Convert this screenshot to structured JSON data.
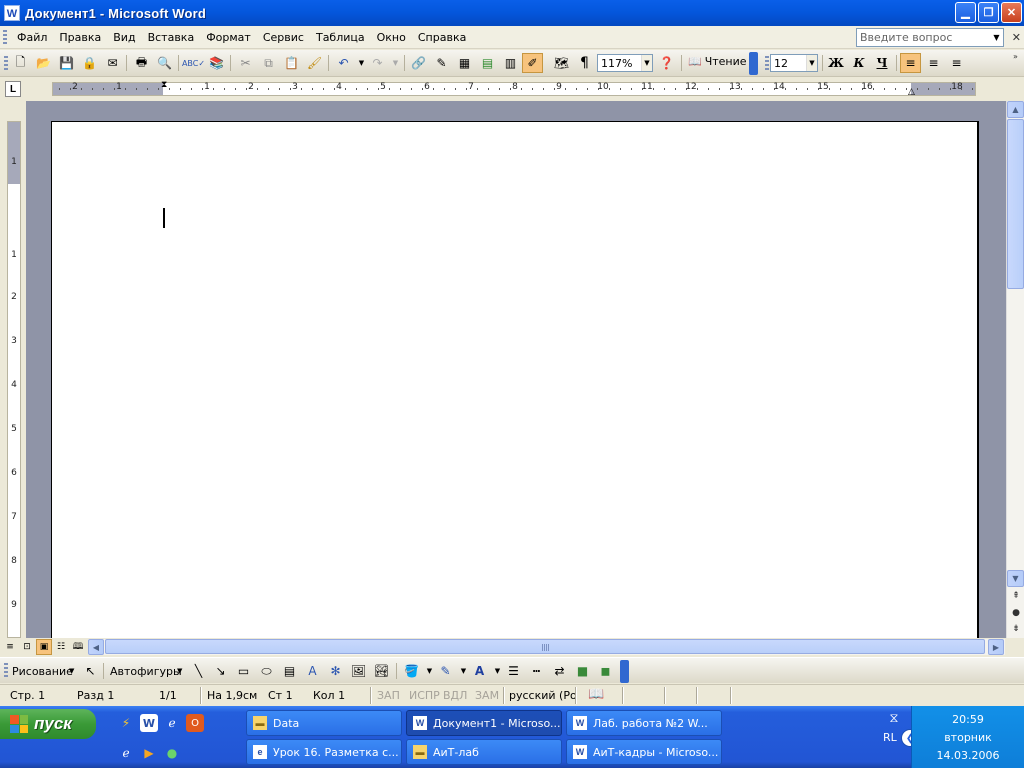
{
  "window": {
    "title": "Документ1 - Microsoft Word",
    "app_icon": "W"
  },
  "menu": {
    "items": [
      "Файл",
      "Правка",
      "Вид",
      "Вставка",
      "Формат",
      "Сервис",
      "Таблица",
      "Окно",
      "Справка"
    ],
    "ask_placeholder": "Введите вопрос"
  },
  "toolbar": {
    "zoom": "117%",
    "reading_label": "Чтение",
    "font_size": "12",
    "bold": "Ж",
    "italic": "К",
    "underline": "Ч"
  },
  "ruler": {
    "h_numbers": [
      "2",
      "1",
      "1",
      "1",
      "2",
      "3",
      "4",
      "5",
      "6",
      "7",
      "8",
      "9",
      "10",
      "11",
      "12",
      "13",
      "14",
      "15",
      "16",
      "18"
    ],
    "v_numbers": [
      "1",
      "1",
      "2",
      "3",
      "4",
      "5",
      "6",
      "7",
      "8",
      "9"
    ]
  },
  "drawing": {
    "draw_label": "Рисование",
    "autoshapes_label": "Автофигуры"
  },
  "status": {
    "page": "Стр. 1",
    "section": "Разд 1",
    "pages": "1/1",
    "position": "На 1,9см",
    "line": "Ст 1",
    "column": "Кол 1",
    "rec": "ЗАП",
    "trk": "ИСПР",
    "ext": "ВДЛ",
    "ovr": "ЗАМ",
    "language": "русский (Ро"
  },
  "taskbar": {
    "start_label": "пуск",
    "tasks_row1": [
      {
        "label": "Data",
        "icon": "folder"
      },
      {
        "label": "Документ1 - Microso...",
        "icon": "word",
        "active": true
      },
      {
        "label": "Лаб. работа №2 W...",
        "icon": "word"
      }
    ],
    "tasks_row2": [
      {
        "label": "Урок 16. Разметка с...",
        "icon": "ie"
      },
      {
        "label": "АиТ-лаб",
        "icon": "folder"
      },
      {
        "label": "АиТ-кадры - Microso...",
        "icon": "word"
      }
    ],
    "lang": "RL",
    "time": "20:59",
    "weekday": "вторник",
    "date": "14.03.2006"
  }
}
